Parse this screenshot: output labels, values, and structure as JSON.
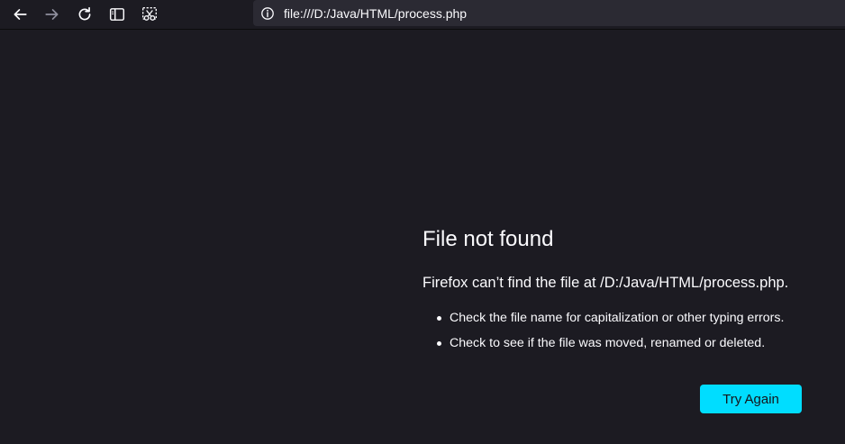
{
  "toolbar": {
    "back_icon": "arrow-left-icon",
    "forward_icon": "arrow-right-icon",
    "reload_icon": "reload-icon",
    "sidebar_icon": "sidebar-icon",
    "screenshot_icon": "screenshot-icon"
  },
  "urlbar": {
    "info_icon": "info-icon",
    "url": "file:///D:/Java/HTML/process.php"
  },
  "error": {
    "title": "File not found",
    "description": "Firefox can’t find the file at /D:/Java/HTML/process.php.",
    "suggestions": [
      "Check the file name for capitalization or other typing errors.",
      "Check to see if the file was moved, renamed or deleted."
    ],
    "button_label": "Try Again"
  },
  "colors": {
    "background": "#1c1b22",
    "urlbar": "#2b2a33",
    "text": "#fbfbfe",
    "accent": "#00ddff"
  }
}
